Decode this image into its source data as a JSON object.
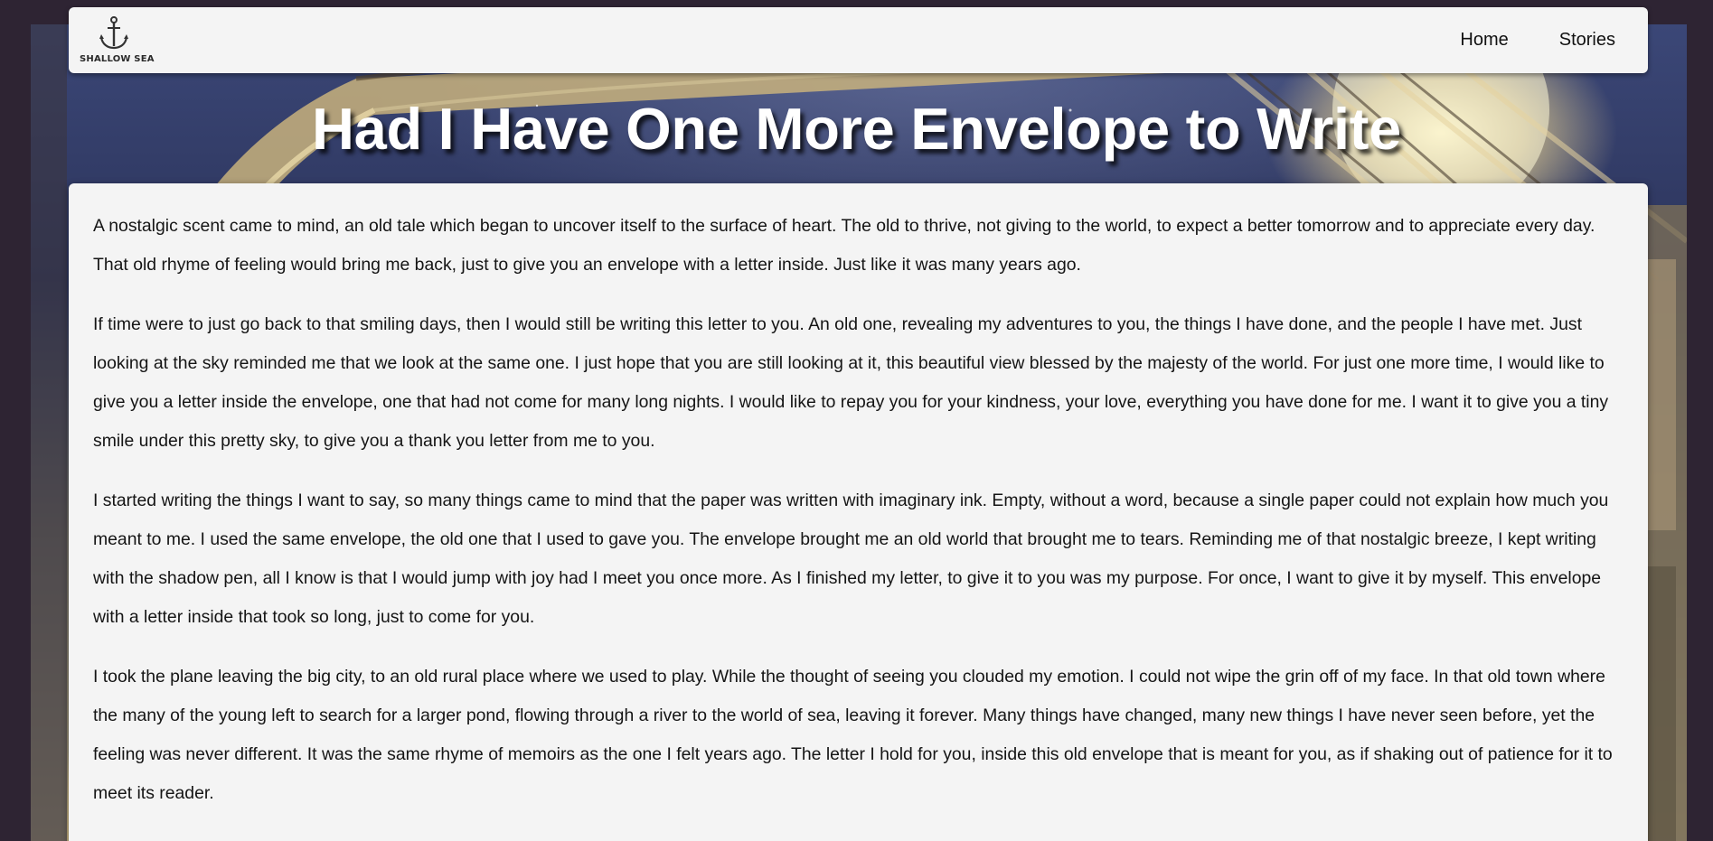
{
  "brand": {
    "name": "SHALLOW SEA",
    "logo_icon": "anchor-icon"
  },
  "nav": {
    "items": [
      {
        "label": "Home"
      },
      {
        "label": "Stories"
      }
    ]
  },
  "story": {
    "title": "Had I Have One More Envelope to Write",
    "paragraphs": [
      "A nostalgic scent came to mind, an old tale which began to uncover itself to the surface of heart. The old to thrive, not giving to the world, to expect a better tomorrow and to appreciate every day. That old rhyme of feeling would bring me back, just to give you an envelope with a letter inside. Just like it was many years ago.",
      "If time were to just go back to that smiling days, then I would still be writing this letter to you. An old one, revealing my adventures to you, the things I have done, and the people I have met. Just looking at the sky reminded me that we look at the same one. I just hope that you are still looking at it, this beautiful view blessed by the majesty of the world. For just one more time, I would like to give you a letter inside the envelope, one that had not come for many long nights. I would like to repay you for your kindness, your love, everything you have done for me. I want it to give you a tiny smile under this pretty sky, to give you a thank you letter from me to you.",
      "I started writing the things I want to say, so many things came to mind that the paper was written with imaginary ink. Empty, without a word, because a single paper could not explain how much you meant to me. I used the same envelope, the old one that I used to gave you. The envelope brought me an old world that brought me to tears. Reminding me of that nostalgic breeze, I kept writing with the shadow pen, all I know is that I would jump with joy had I meet you once more. As I finished my letter, to give it to you was my purpose. For once, I want to give it by myself. This envelope with a letter inside that took so long, just to come for you.",
      "I took the plane leaving the big city, to an old rural place where we used to play. While the thought of seeing you clouded my emotion. I could not wipe the grin off of my face. In that old town where the many of the young left to search for a larger pond, flowing through a river to the world of sea, leaving it forever. Many things have changed, many new things I have never seen before, yet the feeling was never different. It was the same rhyme of memoirs as the one I felt years ago. The letter I hold for you, inside this old envelope that is meant for you, as if shaking out of patience for it to meet its reader."
    ]
  },
  "colors": {
    "page_background": "#2e2433",
    "panel": "#f4f4f4",
    "text": "#151515",
    "title": "#ffffff"
  }
}
